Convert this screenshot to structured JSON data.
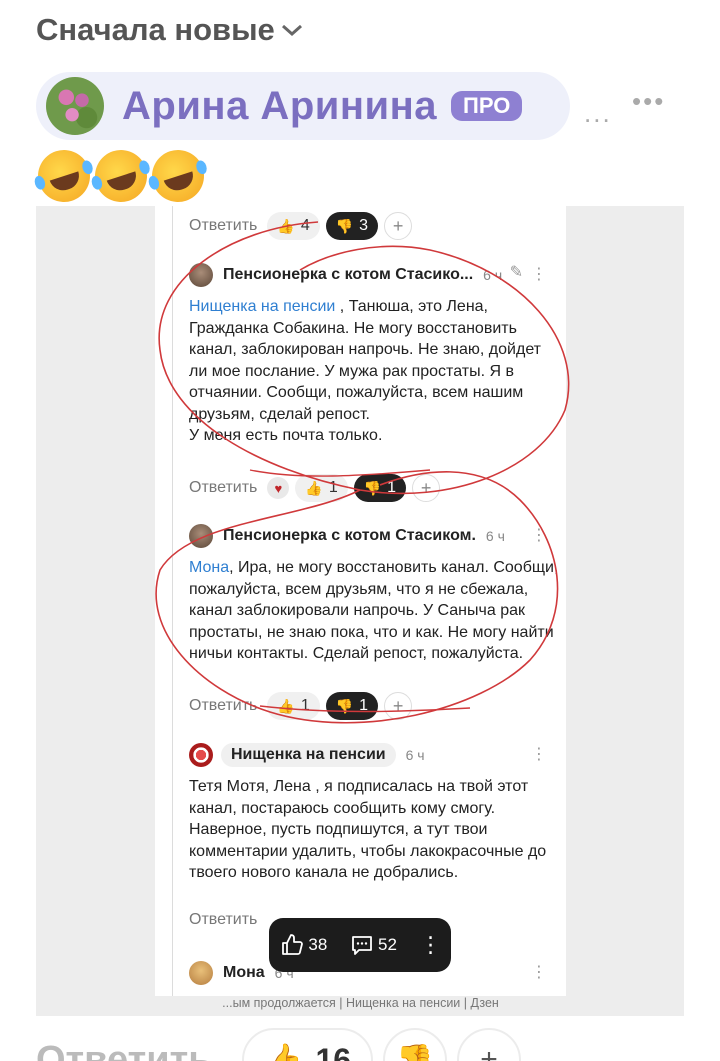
{
  "header": {
    "sort_label": "Сначала новые"
  },
  "author": {
    "name": "Арина Аринина",
    "badge": "ПРО",
    "menu_a": "...",
    "menu_b": "•••"
  },
  "emoji_row": [
    "rolling-on-floor-laughing",
    "rolling-on-floor-laughing",
    "rolling-on-floor-laughing"
  ],
  "screenshot": {
    "top_reactions": {
      "reply": "Ответить",
      "likes": "4",
      "dislikes": "3"
    },
    "comments": [
      {
        "author": "Пенсионерка с котом Стасико...",
        "time": "6 ч",
        "mention": "Нищенка на пенсии",
        "text": " , Танюша, это Лена, Гражданка Собакина. Не могу восстановить канал, заблокирован напрочь. Не знаю, дойдет ли мое послание. У мужа рак простаты. Я в отчаянии. Сообщи, пожалуйста, всем нашим друзьям, сделай репост.",
        "text2": "У меня есть почта только.",
        "reactions": {
          "reply": "Ответить",
          "likes": "1",
          "dislikes": "1"
        }
      },
      {
        "author": "Пенсионерка с котом Стасиком.",
        "time": "6 ч",
        "mention": "Мона",
        "text": ", Ира, не могу восстановить канал. Сообщи, пожалуйста, всем друзьям, что я не сбежала, канал заблокировали напрочь. У Саныча рак простаты, не знаю пока, что и как. Не могу найти ничьи контакты. Сделай репост, пожалуйста.",
        "reactions": {
          "reply": "Ответить",
          "likes": "1",
          "dislikes": "1"
        }
      },
      {
        "author": "Нищенка на пенсии",
        "time": "6 ч",
        "text": "Тетя Мотя, Лена , я подписалась на твой этот канал, постараюсь сообщить кому смогу. Наверное, пусть подпишутся, а тут твои комментарии удалить, чтобы лакокрасочные до твоего нового канала не добрались.",
        "reactions": {
          "reply": "Ответить"
        }
      },
      {
        "author": "Мона",
        "time": "6 ч"
      }
    ],
    "floating_bar": {
      "likes": "38",
      "comments": "52"
    },
    "source_caption": "...ым продолжается | Нищенка на пенсии | Дзен"
  },
  "bottom_bar": {
    "reply": "Ответить",
    "likes": "16"
  },
  "colors": {
    "author_name": "#7b6fc0",
    "pro_badge": "#8e80d2",
    "mention": "#2f7fd1",
    "annotation": "#d0393b"
  }
}
